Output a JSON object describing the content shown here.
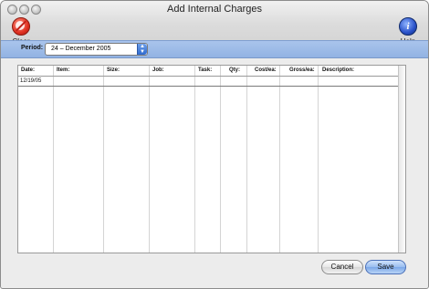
{
  "window": {
    "title": "Add Internal Charges"
  },
  "toolbar": {
    "clear_label": "Clear",
    "help_label": "Help",
    "help_glyph": "i"
  },
  "period": {
    "label": "Period:",
    "value": "24 – December 2005"
  },
  "table": {
    "columns": [
      "Date:",
      "Item:",
      "Size:",
      "Job:",
      "Task:",
      "Qty:",
      "Cost/ea:",
      "Gross/ea:",
      "Description:"
    ],
    "rows": [
      [
        "12/19/05",
        "",
        "",
        "",
        "",
        "",
        "",
        "",
        ""
      ]
    ]
  },
  "buttons": {
    "cancel": "Cancel",
    "save": "Save"
  },
  "colors": {
    "period_bar": "#a9c4ec",
    "save_button": "#98bdf0"
  },
  "icons": {
    "clear": "clear-icon",
    "help": "help-icon"
  }
}
